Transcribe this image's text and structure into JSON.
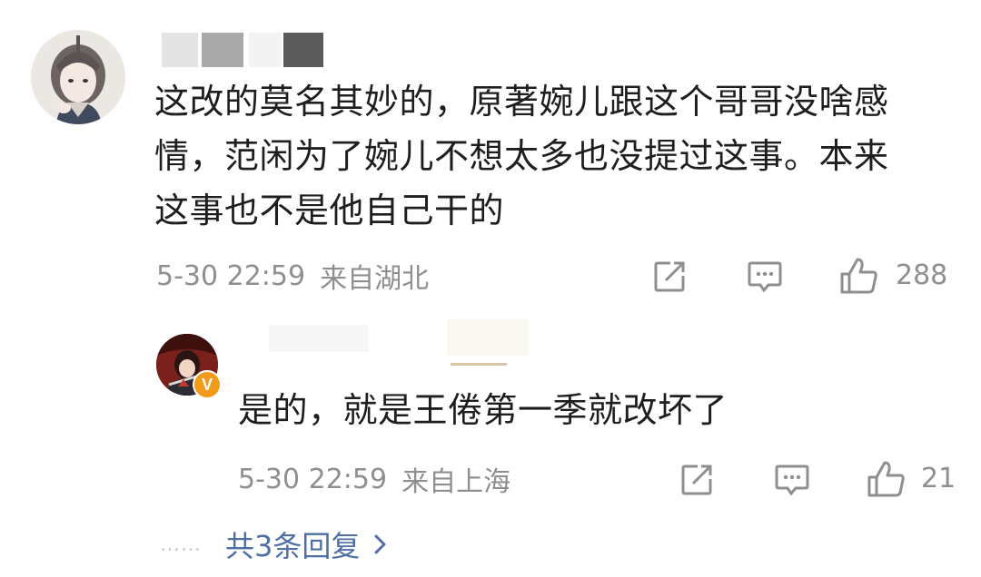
{
  "comment": {
    "text_lines": [
      "这改的莫名其妙的，原著婉儿跟这个哥哥没啥感",
      "情，范闲为了婉儿不想太多也没提过这事。本来",
      "这事也不是他自己干的"
    ],
    "time": "5-30 22:59",
    "location": "来自湖北",
    "like_count": "288"
  },
  "reply": {
    "text": "是的，就是王倦第一季就改坏了",
    "time": "5-30 22:59",
    "location": "来自上海",
    "like_count": "21",
    "verified_badge": "V"
  },
  "more_replies": {
    "dots": "……",
    "label": "共3条回复"
  },
  "icons": {
    "share": "share-icon",
    "comment": "comment-icon",
    "like": "thumbs-up-icon",
    "chevron": "chevron-right-icon"
  },
  "colors": {
    "text": "#1e1e1e",
    "meta": "#8f8f8f",
    "link": "#4e6fa6",
    "badge": "#f29b1a"
  }
}
